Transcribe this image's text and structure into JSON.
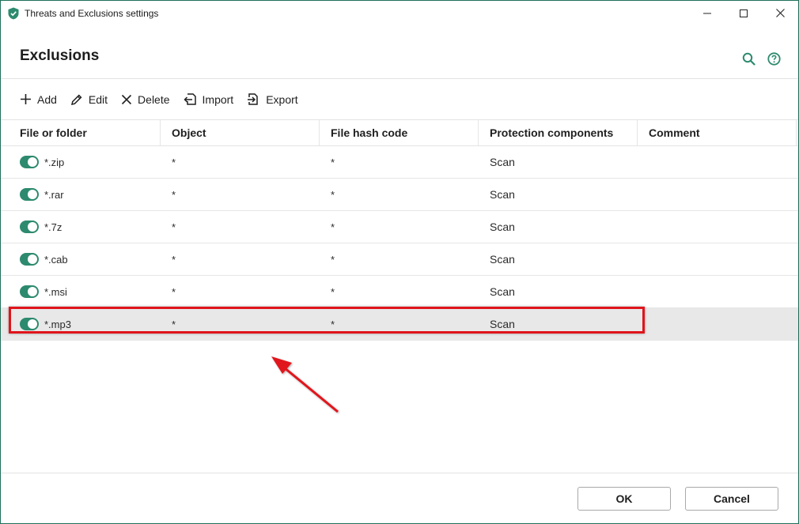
{
  "window": {
    "title": "Threats and Exclusions settings",
    "controls": [
      "minimize",
      "maximize",
      "close"
    ]
  },
  "header": {
    "title": "Exclusions",
    "icons": [
      "search-icon",
      "help-icon"
    ]
  },
  "toolbar": {
    "add_label": "Add",
    "edit_label": "Edit",
    "delete_label": "Delete",
    "import_label": "Import",
    "export_label": "Export"
  },
  "table": {
    "columns": [
      "File or folder",
      "Object",
      "File hash code",
      "Protection components",
      "Comment"
    ],
    "rows": [
      {
        "enabled": true,
        "file": "*.zip",
        "object": "*",
        "hash": "*",
        "components": "Scan",
        "comment": ""
      },
      {
        "enabled": true,
        "file": "*.rar",
        "object": "*",
        "hash": "*",
        "components": "Scan",
        "comment": ""
      },
      {
        "enabled": true,
        "file": "*.7z",
        "object": "*",
        "hash": "*",
        "components": "Scan",
        "comment": ""
      },
      {
        "enabled": true,
        "file": "*.cab",
        "object": "*",
        "hash": "*",
        "components": "Scan",
        "comment": ""
      },
      {
        "enabled": true,
        "file": "*.msi",
        "object": "*",
        "hash": "*",
        "components": "Scan",
        "comment": ""
      },
      {
        "enabled": true,
        "file": "*.mp3",
        "object": "*",
        "hash": "*",
        "components": "Scan",
        "comment": "",
        "selected": true
      }
    ]
  },
  "footer": {
    "ok_label": "OK",
    "cancel_label": "Cancel"
  },
  "colors": {
    "accent": "#2d8a6e",
    "annotation": "#e0141b",
    "selected_row": "#e8e8e8"
  }
}
